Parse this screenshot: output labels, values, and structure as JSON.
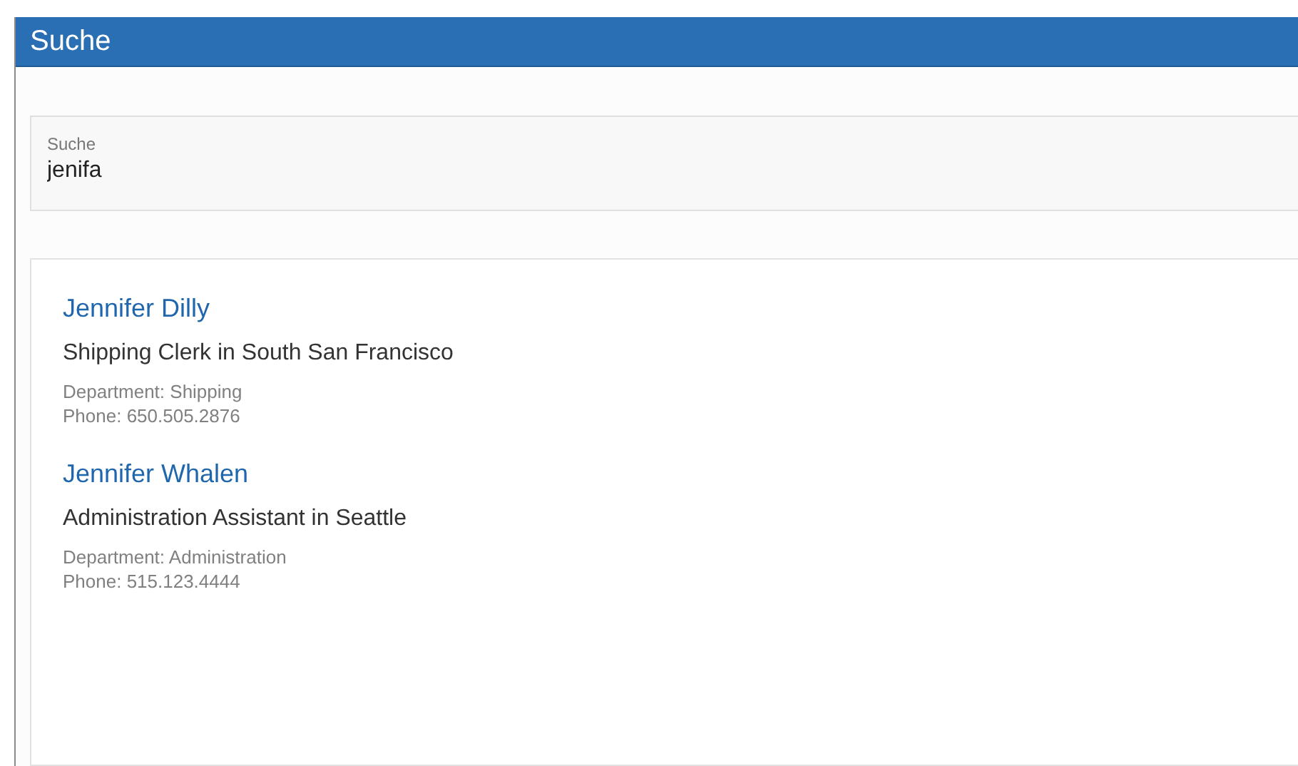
{
  "header": {
    "title": "Suche"
  },
  "search": {
    "label": "Suche",
    "value": "jenifa"
  },
  "results": [
    {
      "name": "Jennifer Dilly",
      "subtitle": "Shipping Clerk in South San Francisco",
      "department": "Department: Shipping",
      "phone": "Phone: 650.505.2876"
    },
    {
      "name": "Jennifer Whalen",
      "subtitle": "Administration Assistant in Seattle",
      "department": "Department: Administration",
      "phone": "Phone: 515.123.4444"
    }
  ]
}
